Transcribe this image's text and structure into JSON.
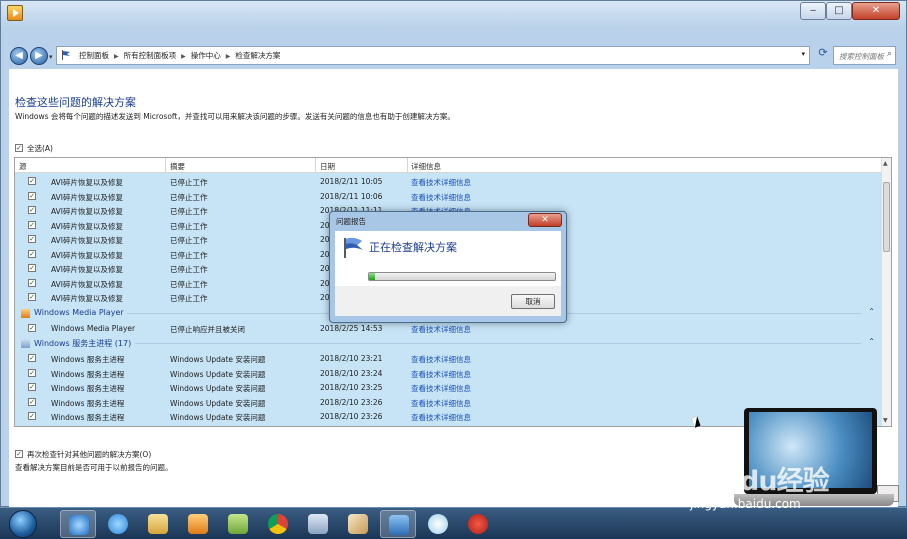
{
  "window": {
    "min_glyph": "‒",
    "max_glyph": "□",
    "close_glyph": "✕"
  },
  "nav": {
    "crumbs": [
      "控制面板",
      "所有控制面板项",
      "操作中心",
      "检查解决方案"
    ],
    "search_placeholder": "搜索控制面板",
    "help": "?"
  },
  "page": {
    "heading": "检查这些问题的解决方案",
    "description": "Windows 会将每个问题的描述发送到 Microsoft，并查找可以用来解决该问题的步骤。发送有关问题的信息也有助于创建解决方案。",
    "select_all": "全选(A)",
    "recheck": "再次检查针对其他问题的解决方案(O)",
    "note": "查看解决方案目前是否可用于以前报告的问题。"
  },
  "list": {
    "columns": [
      "源",
      "摘要",
      "日期",
      "详细信息"
    ],
    "link_text": "查看技术详细信息",
    "group_top_rows": [
      {
        "source": "AVI碎片恢复以及修复",
        "summary": "已停止工作",
        "date": "2018/2/11 10:05"
      },
      {
        "source": "AVI碎片恢复以及修复",
        "summary": "已停止工作",
        "date": "2018/2/11 10:06"
      },
      {
        "source": "AVI碎片恢复以及修复",
        "summary": "已停止工作",
        "date": "2018/2/11 11:11"
      },
      {
        "source": "AVI碎片恢复以及修复",
        "summary": "已停止工作",
        "date": "20"
      },
      {
        "source": "AVI碎片恢复以及修复",
        "summary": "已停止工作",
        "date": "20"
      },
      {
        "source": "AVI碎片恢复以及修复",
        "summary": "已停止工作",
        "date": "20"
      },
      {
        "source": "AVI碎片恢复以及修复",
        "summary": "已停止工作",
        "date": "20"
      },
      {
        "source": "AVI碎片恢复以及修复",
        "summary": "已停止工作",
        "date": "20"
      },
      {
        "source": "AVI碎片恢复以及修复",
        "summary": "已停止工作",
        "date": "20"
      }
    ],
    "group_wmp": {
      "title": "Windows Media Player",
      "rows": [
        {
          "source": "Windows Media Player",
          "summary": "已停止响应并且被关闭",
          "date": "2018/2/25 14:53"
        }
      ]
    },
    "group_svc": {
      "title": "Windows 服务主进程 (17)",
      "rows": [
        {
          "source": "Windows 服务主进程",
          "summary": "Windows Update 安装问题",
          "date": "2018/2/10 23:21"
        },
        {
          "source": "Windows 服务主进程",
          "summary": "Windows Update 安装问题",
          "date": "2018/2/10 23:24"
        },
        {
          "source": "Windows 服务主进程",
          "summary": "Windows Update 安装问题",
          "date": "2018/2/10 23:25"
        },
        {
          "source": "Windows 服务主进程",
          "summary": "Windows Update 安装问题",
          "date": "2018/2/10 23:26"
        },
        {
          "source": "Windows 服务主进程",
          "summary": "Windows Update 安装问题",
          "date": "2018/2/10 23:26"
        }
      ]
    }
  },
  "dialog": {
    "title": "问题报告",
    "message": "正在检查解决方案",
    "progress": 0.03,
    "cancel": "取消"
  },
  "watermark": {
    "main": "Baidu经验",
    "url": "jingyan.baidu.com"
  },
  "colors": {
    "selection": "#c6e4f6",
    "link": "#1a4fbf",
    "heading": "#1a3e8c"
  },
  "taskbar_icons": [
    "start-orb-icon",
    "ie-like-icon",
    "internet-explorer-icon",
    "file-explorer-icon",
    "media-player-icon",
    "folder-icon",
    "chrome-icon",
    "tools-icon",
    "paint-icon",
    "action-center-icon",
    "flower-icon",
    "red-seal-icon"
  ]
}
